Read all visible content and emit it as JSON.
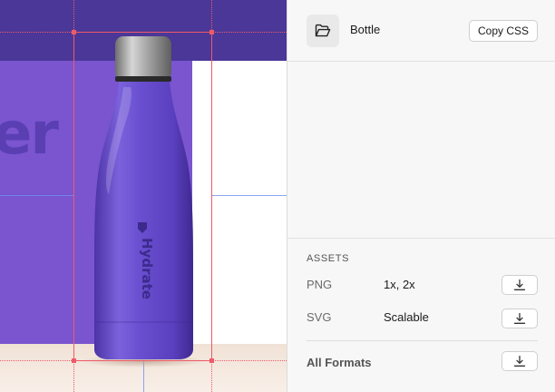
{
  "canvas": {
    "hero_text": "er",
    "bottle_brand": "Hydrate"
  },
  "inspector": {
    "layer_name": "Bottle",
    "layer_icon": "folder-open-icon",
    "copy_css_label": "Copy CSS",
    "assets": {
      "title": "ASSETS",
      "rows": [
        {
          "label": "PNG",
          "value": "1x, 2x"
        },
        {
          "label": "SVG",
          "value": "Scalable"
        }
      ],
      "all_formats_label": "All Formats",
      "download_icon": "download-icon"
    }
  },
  "colors": {
    "top_band": "#4a3797",
    "panel_purple": "#7a55cf",
    "bottle_purple": "#6449c9",
    "selection": "#ef5a6a",
    "guide": "#6f8ff0"
  }
}
